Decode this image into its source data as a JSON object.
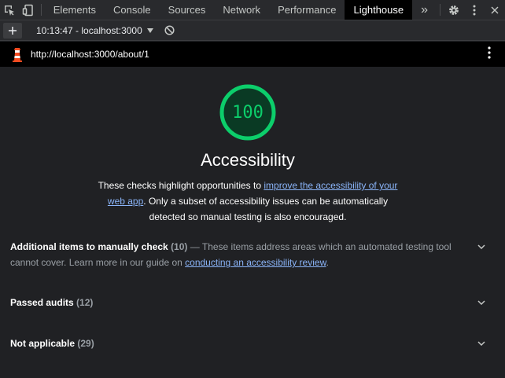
{
  "devtools": {
    "tabs": [
      {
        "label": "Elements"
      },
      {
        "label": "Console"
      },
      {
        "label": "Sources"
      },
      {
        "label": "Network"
      },
      {
        "label": "Performance"
      },
      {
        "label": "Lighthouse"
      }
    ],
    "more_tabs_glyph": "»",
    "active_tab": "Lighthouse"
  },
  "toolbar": {
    "report_select_value": "10:13:47 - localhost:3000"
  },
  "report": {
    "url": "http://localhost:3000/about/1",
    "score": "100",
    "score_color": "#0cce6b",
    "category_title": "Accessibility",
    "description_pre": "These checks highlight opportunities to ",
    "description_link": "improve the accessibility of your web app",
    "description_post": ". Only a subset of accessibility issues can be automatically detected so manual testing is also encouraged."
  },
  "groups": [
    {
      "title": "Additional items to manually check",
      "count": "(10)",
      "desc_pre": " — These items address areas which an automated testing tool cannot cover. Learn more in our guide on ",
      "desc_link": "conducting an accessibility review",
      "desc_post": "."
    },
    {
      "title": "Passed audits",
      "count": "(12)"
    },
    {
      "title": "Not applicable",
      "count": "(29)"
    }
  ],
  "colors": {
    "link": "#8ab4f8",
    "pass_green": "#0cce6b",
    "background": "#202124"
  }
}
